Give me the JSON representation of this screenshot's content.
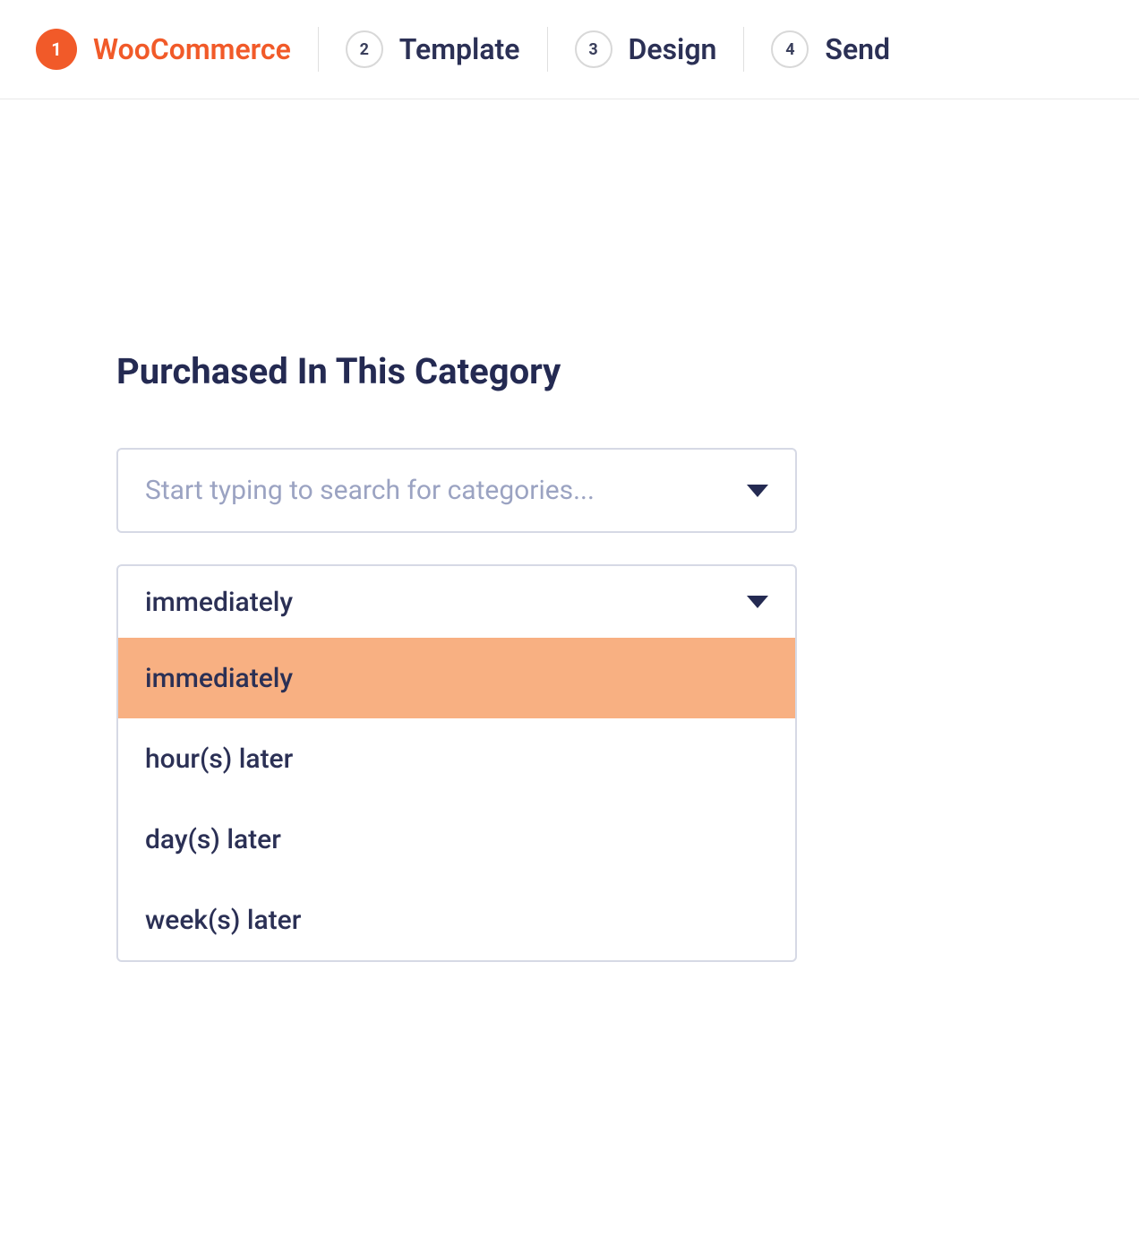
{
  "stepper": {
    "steps": [
      {
        "number": "1",
        "label": "WooCommerce",
        "active": true
      },
      {
        "number": "2",
        "label": "Template",
        "active": false
      },
      {
        "number": "3",
        "label": "Design",
        "active": false
      },
      {
        "number": "4",
        "label": "Send",
        "active": false
      }
    ]
  },
  "section": {
    "title": "Purchased In This Category"
  },
  "categorySearch": {
    "placeholder": "Start typing to search for categories..."
  },
  "timingDropdown": {
    "selected": "immediately",
    "options": [
      {
        "label": "immediately",
        "highlighted": true
      },
      {
        "label": "hour(s) later",
        "highlighted": false
      },
      {
        "label": "day(s) later",
        "highlighted": false
      },
      {
        "label": "week(s) later",
        "highlighted": false
      }
    ]
  }
}
